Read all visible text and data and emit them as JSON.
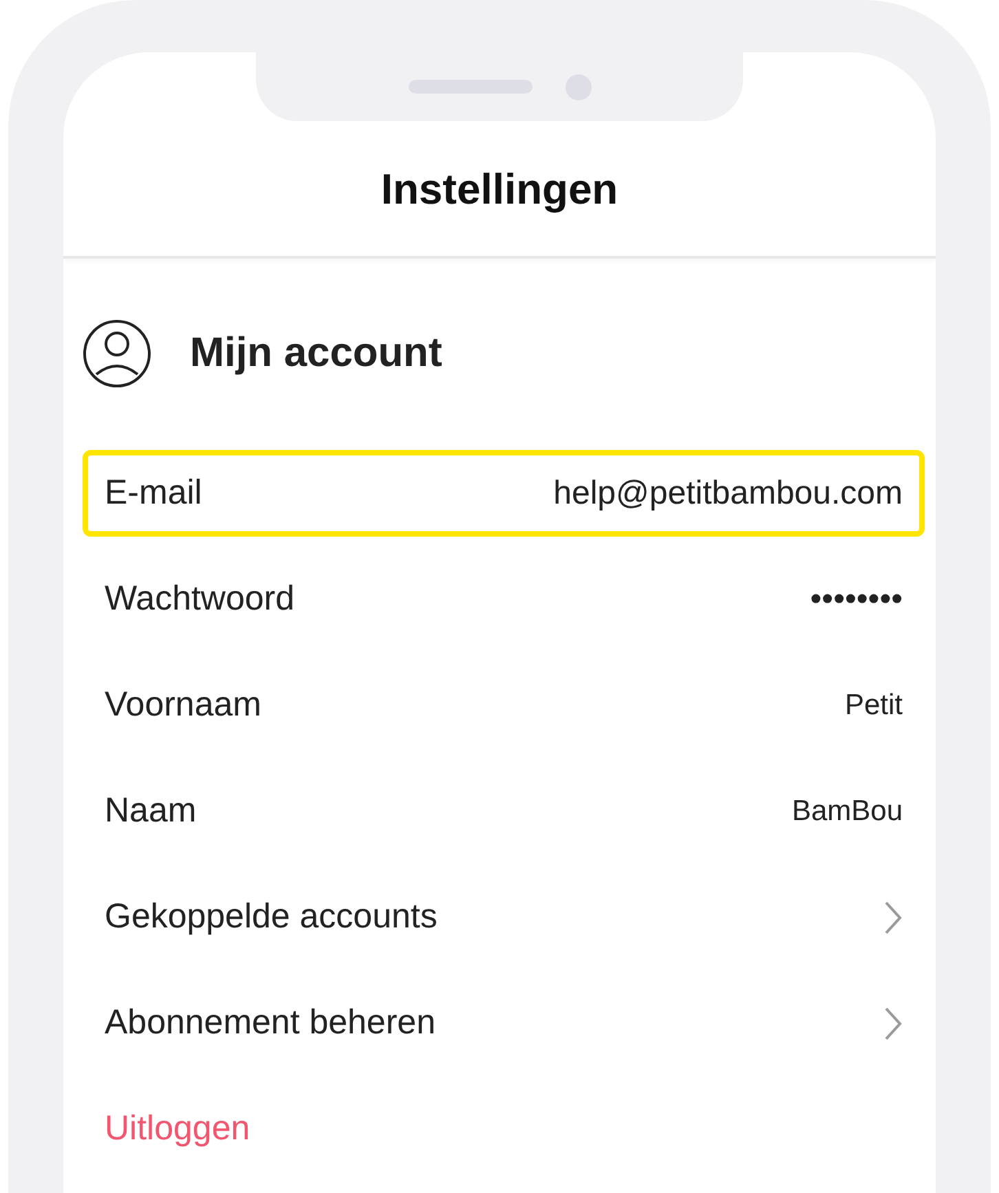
{
  "header": {
    "title": "Instellingen"
  },
  "section": {
    "title": "Mijn account"
  },
  "rows": [
    {
      "kind": "value",
      "label": "E-mail",
      "value": "help@petitbambou.com",
      "highlighted": true,
      "small": false
    },
    {
      "kind": "value",
      "label": "Wachtwoord",
      "value": "••••••••",
      "highlighted": false,
      "small": false
    },
    {
      "kind": "value",
      "label": "Voornaam",
      "value": "Petit",
      "highlighted": false,
      "small": true
    },
    {
      "kind": "value",
      "label": "Naam",
      "value": "BamBou",
      "highlighted": false,
      "small": true
    },
    {
      "kind": "link",
      "label": "Gekoppelde accounts",
      "highlighted": false
    },
    {
      "kind": "link",
      "label": "Abonnement beheren",
      "highlighted": false
    },
    {
      "kind": "action",
      "label": "Uitloggen",
      "highlighted": false
    }
  ]
}
